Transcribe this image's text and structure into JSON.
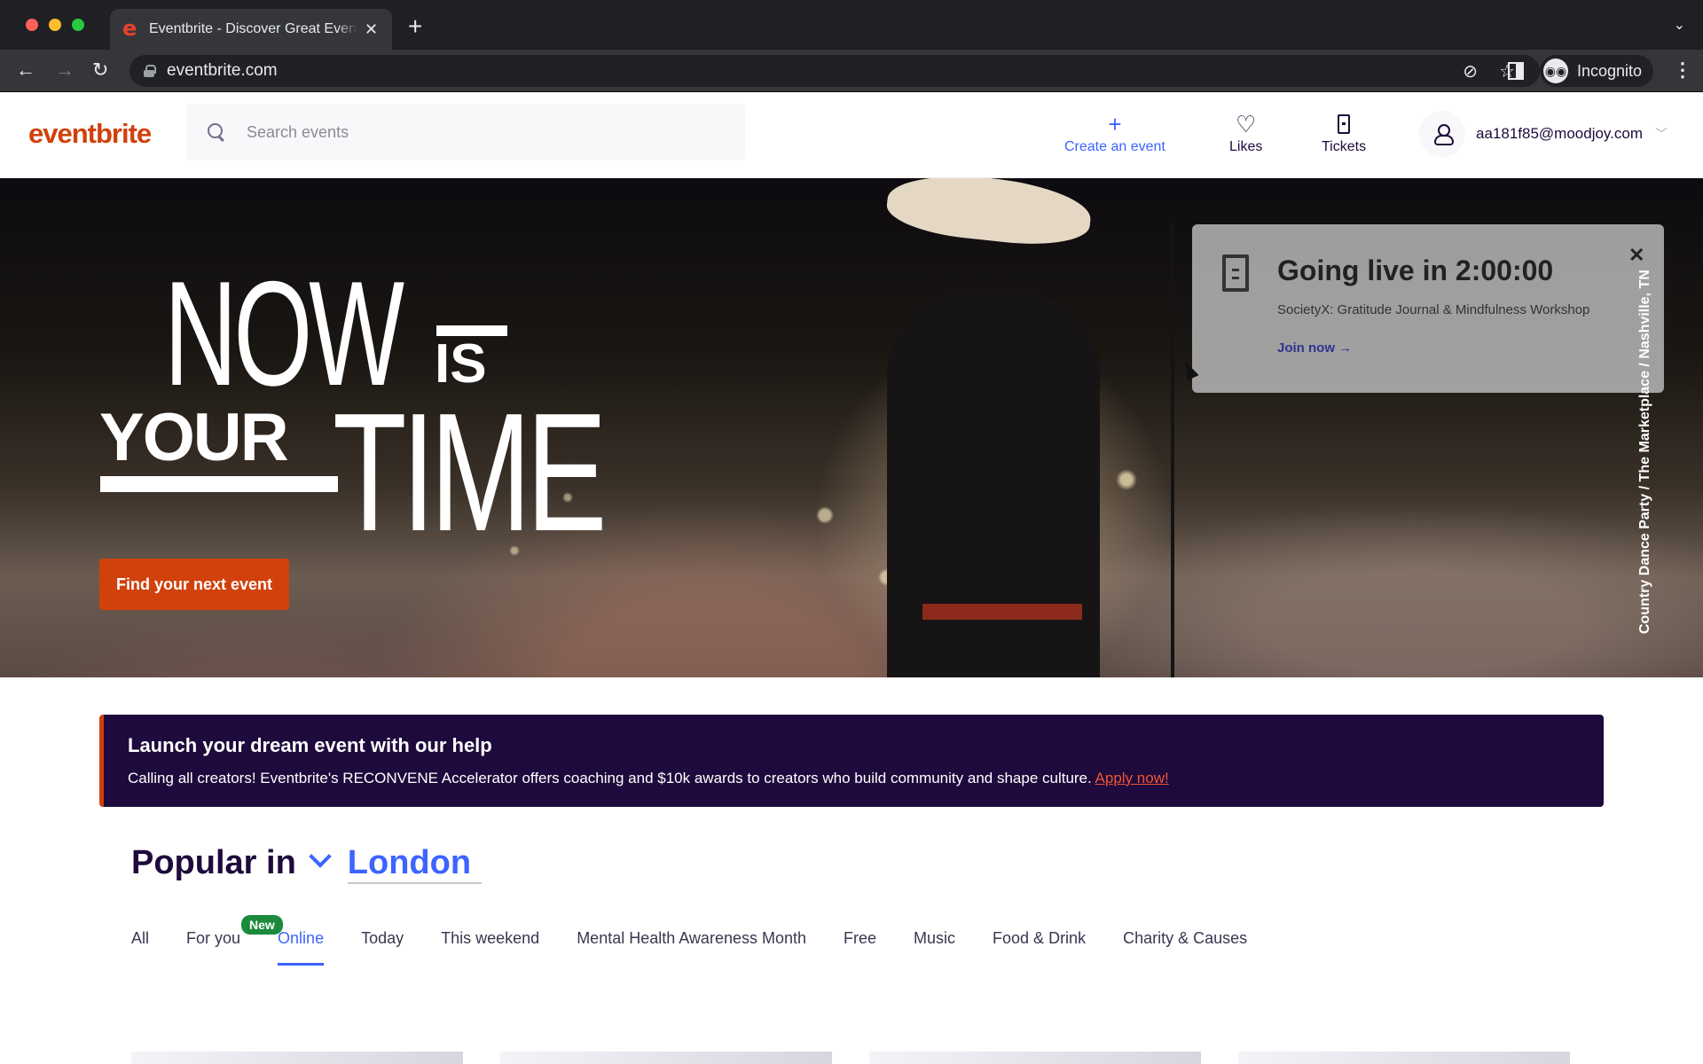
{
  "browser": {
    "tab_title": "Eventbrite - Discover Great Events",
    "url": "eventbrite.com",
    "profile_label": "Incognito",
    "icons": [
      "back-icon",
      "forward-icon",
      "reload-icon",
      "lock-icon",
      "eye-off-icon",
      "star-icon",
      "side-panel-icon",
      "incognito-icon",
      "more-icon"
    ]
  },
  "header": {
    "logo": "eventbrite",
    "search_placeholder": "Search events",
    "nav": [
      {
        "label": "Create an event",
        "icon": "plus-icon"
      },
      {
        "label": "Likes",
        "icon": "heart-icon"
      },
      {
        "label": "Tickets",
        "icon": "ticket-icon"
      }
    ],
    "account_email": "aa181f85@moodjoy.com"
  },
  "hero": {
    "headline": {
      "now": "NOW",
      "is": "IS",
      "your": "YOUR",
      "time": "TIME"
    },
    "cta_label": "Find your next event",
    "caption": "Country Dance Party / The Marketplace / Nashville, TN",
    "live_card": {
      "title": "Going live in 2:00:00",
      "event": "SocietyX: Gratitude Journal & Mindfulness Workshop",
      "join_label": "Join now →"
    }
  },
  "banner": {
    "title": "Launch your dream event with our help",
    "text": "Calling all creators! Eventbrite's RECONVENE Accelerator offers coaching and $10k awards to creators who build community and shape culture. ",
    "link_label": "Apply now!"
  },
  "popular": {
    "label": "Popular in",
    "location": "London",
    "tabs": [
      {
        "label": "All",
        "active": false
      },
      {
        "label": "For you",
        "active": false,
        "badge": "New"
      },
      {
        "label": "Online",
        "active": true
      },
      {
        "label": "Today",
        "active": false
      },
      {
        "label": "This weekend",
        "active": false
      },
      {
        "label": "Mental Health Awareness Month",
        "active": false
      },
      {
        "label": "Free",
        "active": false
      },
      {
        "label": "Music",
        "active": false
      },
      {
        "label": "Food & Drink",
        "active": false
      },
      {
        "label": "Charity & Causes",
        "active": false
      }
    ]
  },
  "colors": {
    "brand": "#d1410c",
    "accent": "#3d64ff",
    "banner_bg": "#1e0a3c",
    "badge_green": "#1c8a3c"
  }
}
